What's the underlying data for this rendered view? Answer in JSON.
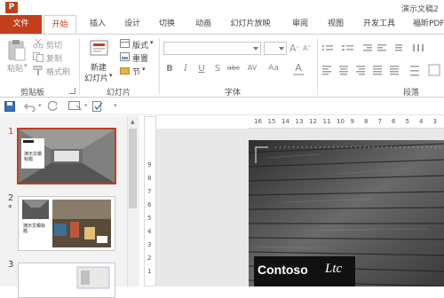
{
  "app": {
    "icon_letter": "P",
    "window_title": "演示文稿2"
  },
  "tabs": [
    {
      "label": "文件"
    },
    {
      "label": "开始"
    },
    {
      "label": "插入"
    },
    {
      "label": "设计"
    },
    {
      "label": "切换"
    },
    {
      "label": "动画"
    },
    {
      "label": "幻灯片放映"
    },
    {
      "label": "审阅"
    },
    {
      "label": "视图"
    },
    {
      "label": "开发工具"
    },
    {
      "label": "福昕PDF"
    }
  ],
  "ribbon": {
    "clipboard": {
      "paste": "粘贴",
      "cut": "剪切",
      "copy": "复制",
      "format_painter": "格式刷",
      "label": "剪贴板"
    },
    "slides": {
      "new_slide_line1": "新建",
      "new_slide_line2": "幻灯片",
      "layout": "版式",
      "reset": "重置",
      "section": "节",
      "label": "幻灯片"
    },
    "font": {
      "bold": "B",
      "italic": "I",
      "underline": "U",
      "shadow": "S",
      "strike": "abc",
      "spacing": "AV",
      "case": "Aa",
      "color": "A",
      "label": "字体"
    },
    "paragraph": {
      "label": "段落"
    }
  },
  "slides_panel": {
    "slides": [
      {
        "number": "1",
        "title": "演示文稿标题"
      },
      {
        "number": "2",
        "marker": "*",
        "title": "演示文稿标题"
      },
      {
        "number": "3"
      }
    ]
  },
  "ruler": {
    "labels": [
      "16",
      "15",
      "14",
      "13",
      "12",
      "11",
      "10",
      "9",
      "8",
      "7",
      "6",
      "5",
      "4",
      "3"
    ]
  },
  "vruler": {
    "labels": [
      "9",
      "8",
      "7",
      "6",
      "5",
      "4",
      "3",
      "2",
      "1"
    ]
  },
  "slide": {
    "logo_text": "Contoso",
    "logo_suffix": "Ltc"
  },
  "colors": {
    "accent": "#c43e1c",
    "selected_border": "#c43e1c"
  }
}
